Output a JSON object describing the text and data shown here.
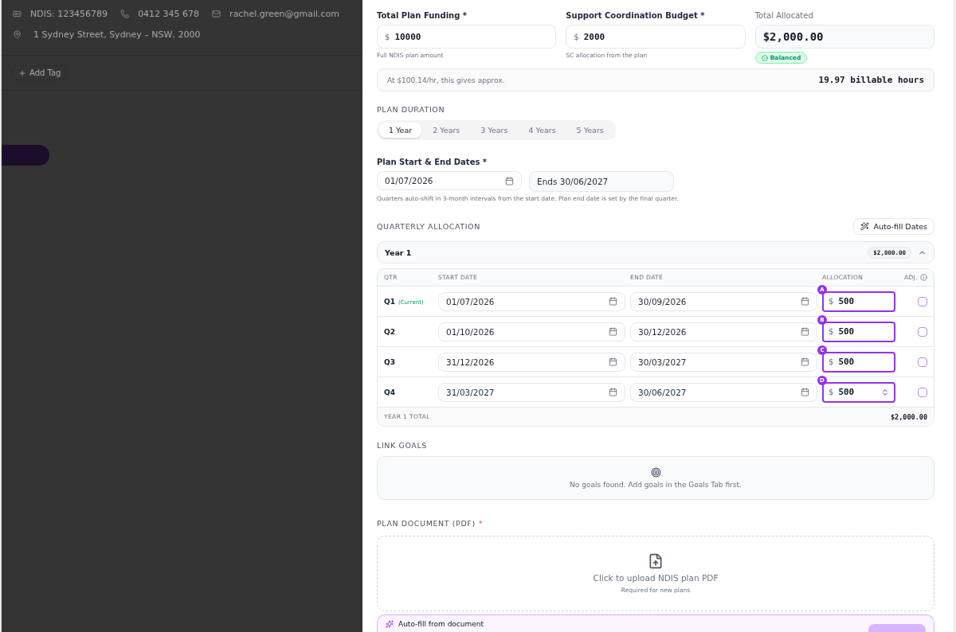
{
  "background": {
    "contacts": [
      {
        "kind": "id",
        "text": "NDIS: 123456789"
      },
      {
        "kind": "phone",
        "text": "0412 345 678"
      },
      {
        "kind": "email",
        "text": "rachel.green@gmail.com"
      }
    ],
    "address": "1 Sydney Street, Sydney – NSW, 2000",
    "add_tag": "Add Tag"
  },
  "funding": {
    "fields": [
      {
        "label": "Total Plan Funding *",
        "prefix": "$",
        "value": "10000",
        "hint": "Full NDIS plan amount"
      },
      {
        "label": "Support Coordination Budget *",
        "prefix": "$",
        "value": "2000",
        "hint": "SC allocation from the plan"
      }
    ],
    "total": {
      "label": "Total Allocated",
      "value": "$2,000.00",
      "badge": "Balanced"
    },
    "rate_note": "At $100.14/hr, this gives approx.",
    "hours": "19.97 billable hours"
  },
  "duration": {
    "heading": "PLAN DURATION",
    "options": [
      {
        "label": "1 Year",
        "selected": true
      },
      {
        "label": "2 Years",
        "selected": false
      },
      {
        "label": "3 Years",
        "selected": false
      },
      {
        "label": "4 Years",
        "selected": false
      },
      {
        "label": "5 Years",
        "selected": false
      }
    ]
  },
  "dates": {
    "label": "Plan Start & End Dates *",
    "start": "01/07/2026",
    "end": "Ends 30/06/2027",
    "hint": "Quarters auto-shift in 3-month intervals from the start date. Plan end date is set by the final quarter."
  },
  "quarterly": {
    "heading": "QUARTERLY ALLOCATION",
    "autofill": "Auto-fill Dates",
    "year": {
      "label": "Year 1",
      "total": "$2,000.00",
      "expanded": true
    },
    "columns": [
      "QTR",
      "START DATE",
      "END DATE",
      "ALLOCATION",
      "ADJ."
    ],
    "rows": [
      {
        "qtr": "Q1",
        "tag": "(Current)",
        "start": "01/07/2026",
        "end": "30/09/2026",
        "prefix": "$",
        "allocation": "500",
        "marker": "A",
        "focused": false,
        "adjusted": false
      },
      {
        "qtr": "Q2",
        "start": "01/10/2026",
        "end": "30/12/2026",
        "prefix": "$",
        "allocation": "500",
        "marker": "B",
        "focused": false,
        "adjusted": false
      },
      {
        "qtr": "Q3",
        "start": "31/12/2026",
        "end": "30/03/2027",
        "prefix": "$",
        "allocation": "500",
        "marker": "C",
        "focused": false,
        "adjusted": false
      },
      {
        "qtr": "Q4",
        "start": "31/03/2027",
        "end": "30/06/2027",
        "prefix": "$",
        "allocation": "500",
        "marker": "D",
        "focused": true,
        "adjusted": false
      }
    ],
    "footer": {
      "label": "YEAR 1 TOTAL",
      "value": "$2,000.00"
    }
  },
  "goals": {
    "heading": "LINK GOALS",
    "empty": "No goals found. Add goals in the Goals Tab first."
  },
  "document": {
    "heading": "PLAN DOCUMENT (PDF)",
    "required": "*",
    "upload": "Click to upload NDIS plan PDF",
    "hint": "Required for new plans"
  },
  "autofill_bar": {
    "label": "Auto-fill from document"
  }
}
